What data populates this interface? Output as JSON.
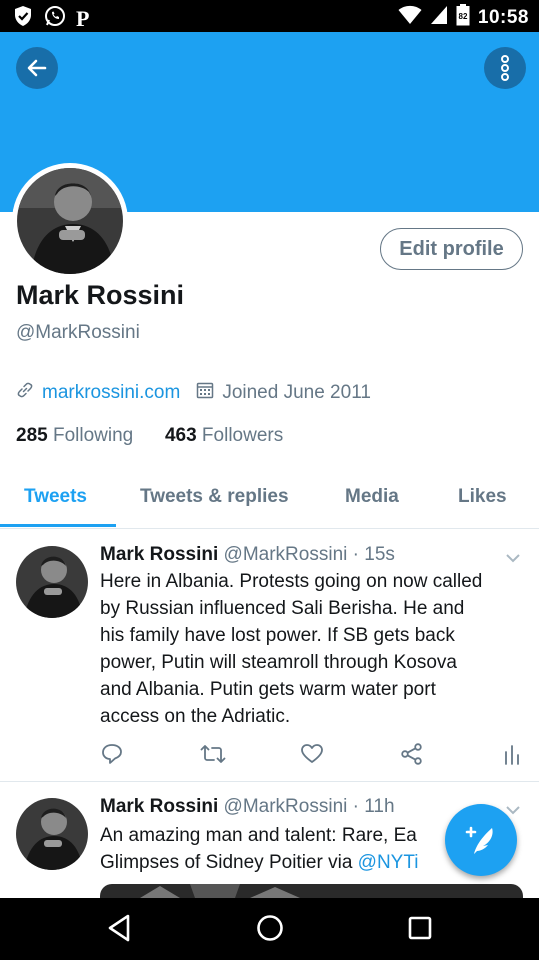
{
  "status_bar": {
    "left_icons": [
      "shield-check-icon",
      "whatsapp-icon",
      "parking-icon"
    ],
    "p_label": "P",
    "battery_level": "82",
    "time": "10:58"
  },
  "profile": {
    "name": "Mark Rossini",
    "handle": "@MarkRossini",
    "website": "markrossini.com",
    "joined": "Joined June 2011",
    "following_count": "285",
    "following_label": "Following",
    "followers_count": "463",
    "followers_label": "Followers",
    "edit_label": "Edit profile"
  },
  "tabs": [
    {
      "label": "Tweets",
      "active": true
    },
    {
      "label": "Tweets & replies",
      "active": false
    },
    {
      "label": "Media",
      "active": false
    },
    {
      "label": "Likes",
      "active": false
    }
  ],
  "tweets": [
    {
      "name": "Mark Rossini",
      "handle": "@MarkRossini",
      "time": "· 15s",
      "lines": [
        "Here in Albania. Protests going on now called",
        "by Russian influenced Sali Berisha.  He and",
        "his family have lost power.  If SB gets back",
        "power, Putin will steamroll through Kosova",
        "and Albania. Putin gets warm water port",
        "access on the Adriatic."
      ]
    },
    {
      "name": "Mark Rossini",
      "handle": "@MarkRossini",
      "time": "· 11h",
      "line1": "An amazing man and talent:  Rare, Ea",
      "line2_text": "Glimpses of Sidney Poitier   via ",
      "line2_mention": "@NYTi"
    }
  ],
  "colors": {
    "brand": "#1da1f2",
    "link": "#1b95e0",
    "muted": "#657786",
    "text": "#14171a"
  }
}
